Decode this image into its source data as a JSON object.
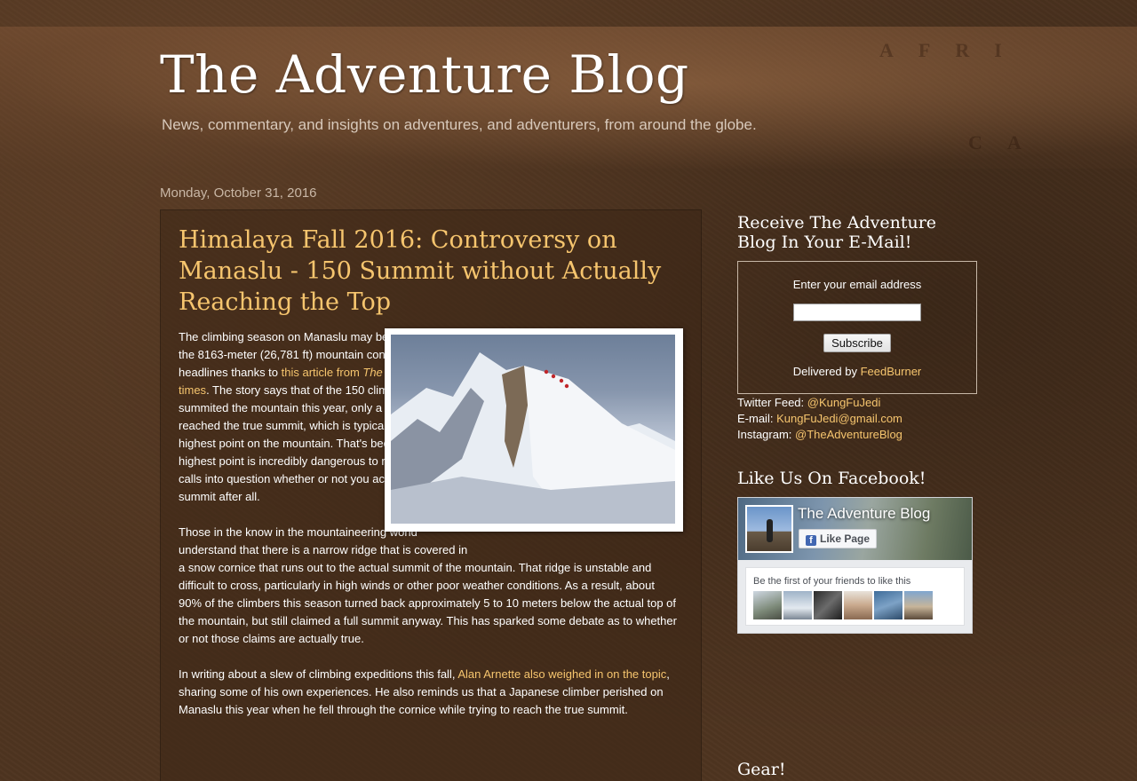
{
  "blog": {
    "title": "The Adventure Blog",
    "description": "News, commentary, and insights on adventures, and adventurers, from around the globe."
  },
  "post": {
    "date": "Monday, October 31, 2016",
    "title": "Himalaya Fall 2016: Controversy on Manaslu - 150 Summit without Actually Reaching the Top",
    "p1": {
      "text_a": "The climbing season on Manaslu may be long over, but the 8163-meter (26,781 ft) mountain continues to garner headlines thanks to ",
      "link_a": "this article from ",
      "link_em": "The Himalayan",
      "link_b": " times",
      "text_b": ". The story says that of the 150 climbers who summited the mountain this year, only a fraction actually reached the true summit, which is typically defined as the highest point on the mountain. That's because Manaslu's highest point is incredibly dangerous to reach, which calls into question whether or not you actually did get the summit after all."
    },
    "p2": "Those in the know in the mountaineering world understand that there is a narrow ridge that is covered in a snow cornice that runs out to the actual summit of the mountain. That ridge is unstable and difficult to cross, particularly in high winds or other poor weather conditions. As a result, about 90% of the climbers this season turned back approximately 5 to 10 meters below the actual top of the mountain, but still claimed a full summit anyway. This has sparked some debate as to whether or not those claims are actually true.",
    "p3": {
      "text_a": "In writing about a slew of climbing expeditions this fall, ",
      "link": "Alan Arnette also weighed in on the topic",
      "text_b": ", sharing some of his own experiences. He also reminds us that a Japanese climber perished on Manaslu this year when he fell through the cornice while trying to reach the true summit."
    }
  },
  "sidebar": {
    "email_widget": {
      "title": "Receive The Adventure Blog In Your E-Mail!",
      "label": "Enter your email address",
      "input_value": "",
      "button": "Subscribe",
      "delivered_by": "Delivered by ",
      "feedburner": "FeedBurner"
    },
    "contact": {
      "twitter_label": "Twitter Feed: ",
      "twitter": "@KungFuJedi",
      "email_label": "E-mail: ",
      "email": "KungFuJedi@gmail.com",
      "instagram_label": "Instagram: ",
      "instagram": "@TheAdventureBlog"
    },
    "facebook": {
      "title": "Like Us On Facebook!",
      "page_name": "The Adventure Blog",
      "like_button": "Like Page",
      "friends_text": "Be the first of your friends to like this"
    },
    "gear_title": "Gear!"
  },
  "colors": {
    "link": "#f6c56e",
    "background": "#4e3420"
  }
}
